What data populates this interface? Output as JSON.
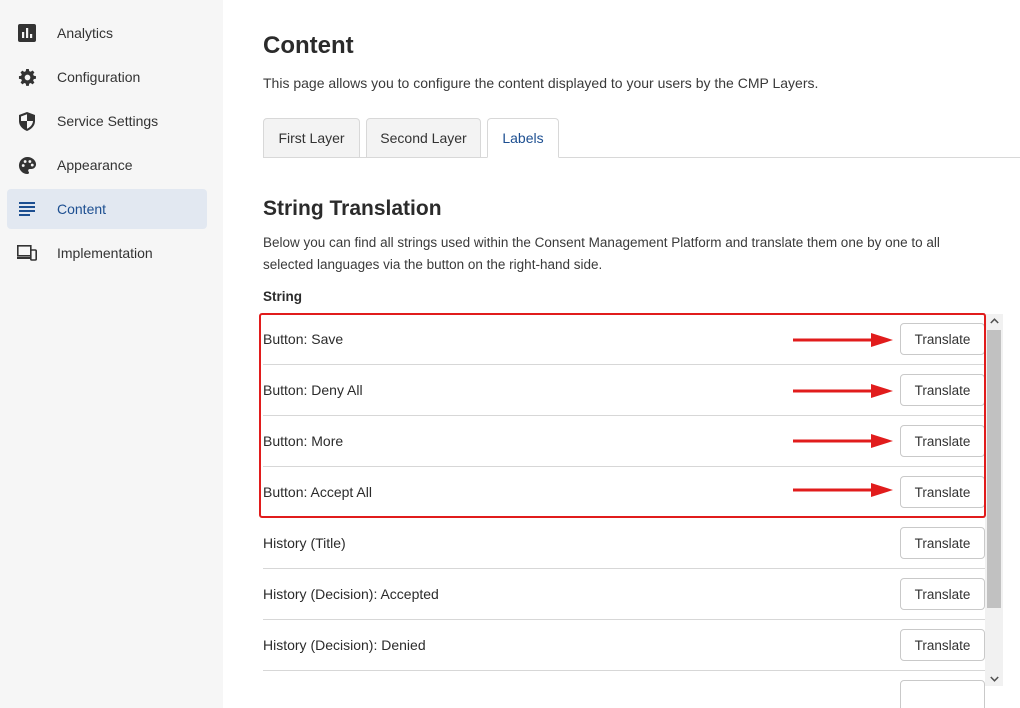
{
  "sidebar": {
    "items": [
      {
        "label": "Analytics",
        "icon": "bar-chart-icon"
      },
      {
        "label": "Configuration",
        "icon": "gear-icon"
      },
      {
        "label": "Service Settings",
        "icon": "shield-icon"
      },
      {
        "label": "Appearance",
        "icon": "palette-icon"
      },
      {
        "label": "Content",
        "icon": "text-lines-icon",
        "active": true
      },
      {
        "label": "Implementation",
        "icon": "devices-icon"
      }
    ]
  },
  "main": {
    "title": "Content",
    "description": "This page allows you to configure the content displayed to your users by the CMP Layers.",
    "tabs": [
      {
        "label": "First Layer"
      },
      {
        "label": "Second Layer"
      },
      {
        "label": "Labels",
        "active": true
      }
    ],
    "section": {
      "title": "String Translation",
      "description": "Below you can find all strings used within the Consent Management Platform and translate them one by one to all selected languages via the button on the right-hand side.",
      "column_header": "String",
      "rows": [
        {
          "label": "Button: Save",
          "button": "Translate"
        },
        {
          "label": "Button: Deny All",
          "button": "Translate"
        },
        {
          "label": "Button: More",
          "button": "Translate"
        },
        {
          "label": "Button: Accept All",
          "button": "Translate"
        },
        {
          "label": "History (Title)",
          "button": "Translate"
        },
        {
          "label": "History (Decision): Accepted",
          "button": "Translate"
        },
        {
          "label": "History (Decision): Denied",
          "button": "Translate"
        },
        {
          "label": "",
          "button": ""
        }
      ]
    }
  },
  "colors": {
    "accent": "#1d4f91",
    "active_nav_bg": "#e2e8f1",
    "annotation": "#e11c1c"
  }
}
